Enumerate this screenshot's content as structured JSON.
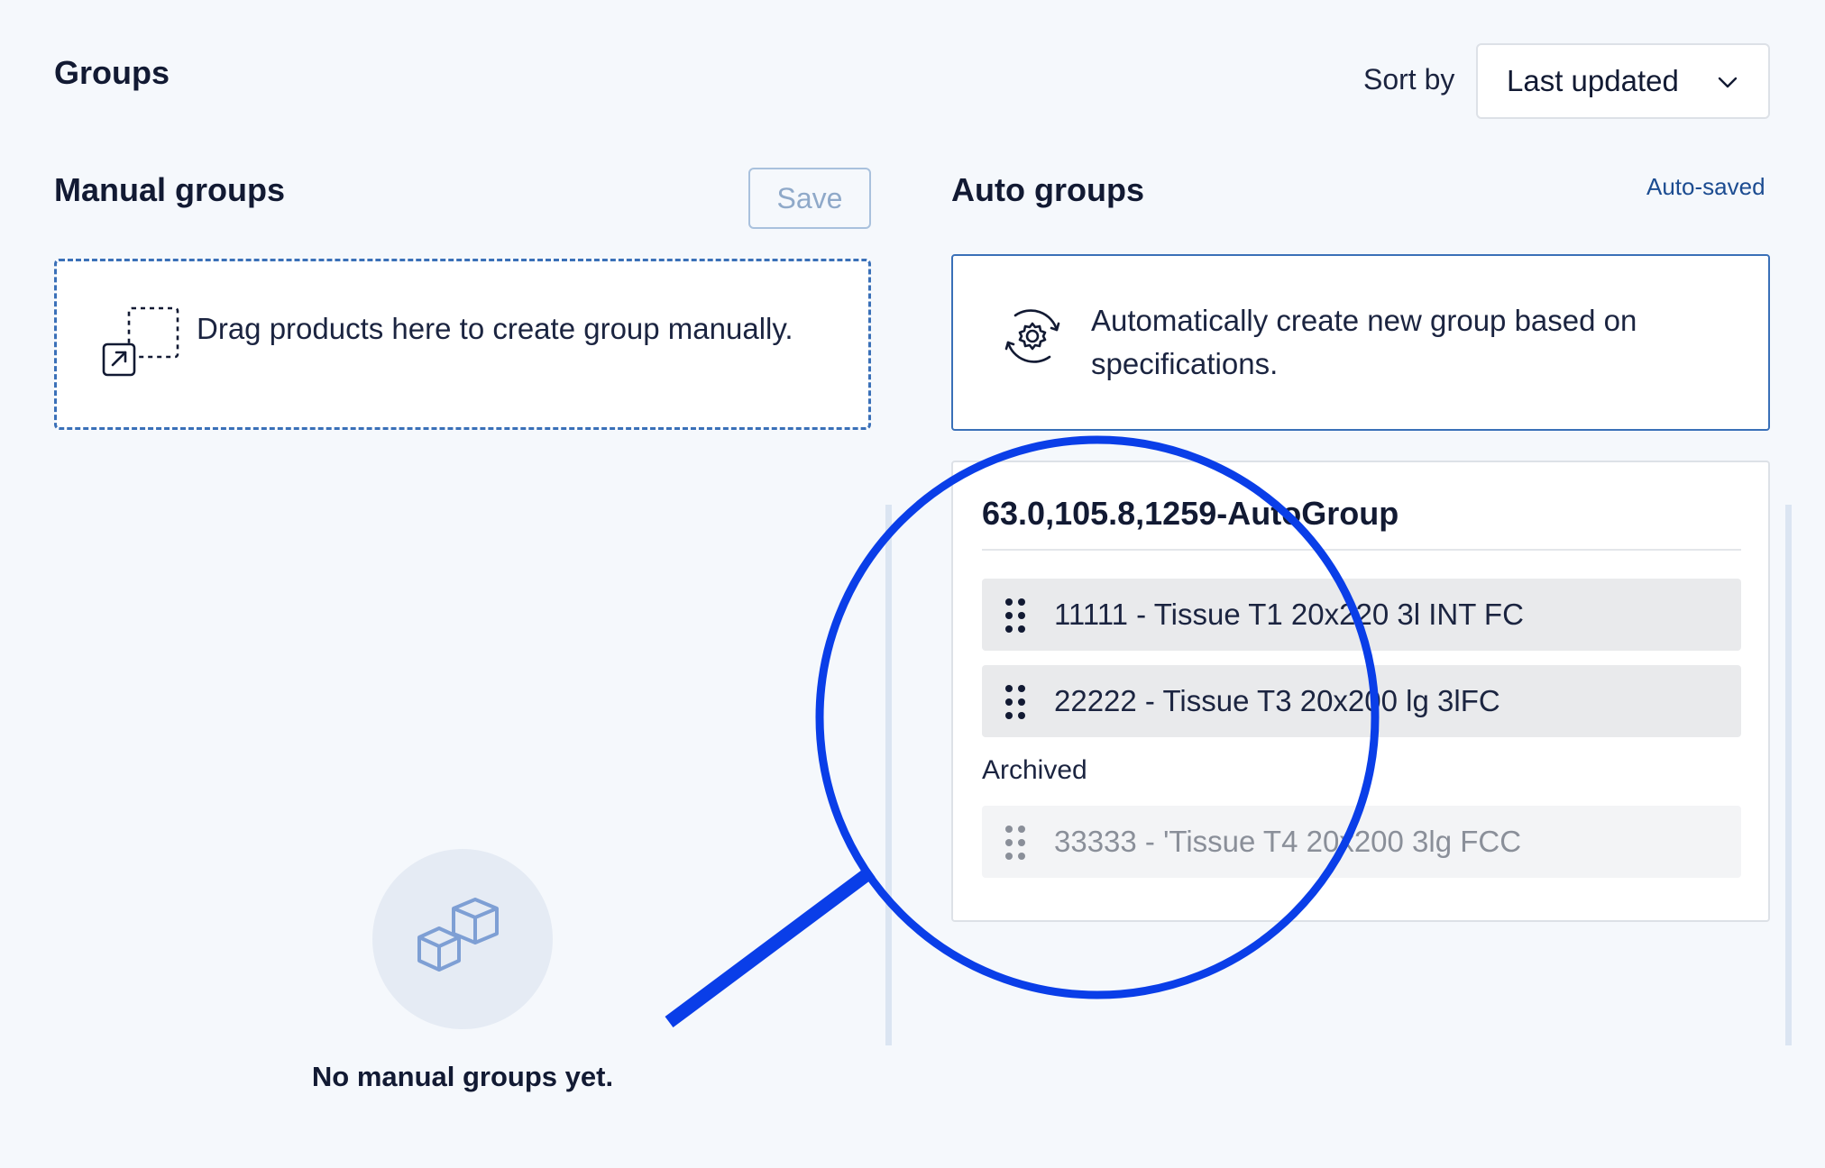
{
  "header": {
    "title": "Groups",
    "sort_label": "Sort by",
    "sort_value": "Last updated"
  },
  "manual": {
    "title": "Manual groups",
    "save_label": "Save",
    "drop_text": "Drag products here to create group manually.",
    "empty_text": "No manual groups yet."
  },
  "auto": {
    "title": "Auto groups",
    "status": "Auto-saved",
    "create_text": "Automatically create new group based on specifications.",
    "group": {
      "title": "63.0,105.8,1259-AutoGroup",
      "items": [
        {
          "label": "11111 - Tissue T1 20x220 3l INT FC"
        },
        {
          "label": "22222 - Tissue T3 20x200 lg 3lFC"
        }
      ],
      "archived_label": "Archived",
      "archived_items": [
        {
          "label": "33333 - 'Tissue T4 20x200 3lg FCC"
        }
      ]
    }
  },
  "icons": {
    "sort": "chevron-down-icon",
    "drop": "drag-to-group-icon",
    "auto": "gear-cycle-icon",
    "empty": "boxes-icon",
    "grip": "drag-handle-icon",
    "overlay": "magnifier-overlay"
  },
  "colors": {
    "accent": "#3a70b8",
    "link": "#1c4c91",
    "magnifier": "#0a3ee8",
    "background": "#f5f8fc"
  }
}
